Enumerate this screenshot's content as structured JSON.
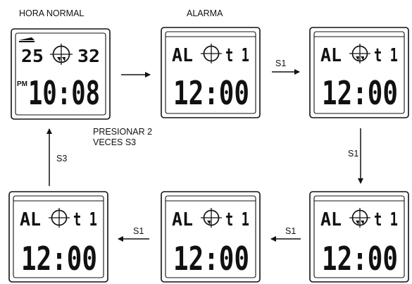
{
  "labels": {
    "hora_normal": "HORA NORMAL",
    "alarma": "ALARMA",
    "presionar": "PRESIONAR 2 VECES S3"
  },
  "buttons": {
    "s1": "S1",
    "s3": "S3"
  },
  "normal_display": {
    "left_number": "25",
    "right_number": "32",
    "am_pm": "PM",
    "time": "10:08"
  },
  "alarm_display": {
    "prefix": "AL",
    "suffix": "t 1",
    "time": "12:00"
  }
}
